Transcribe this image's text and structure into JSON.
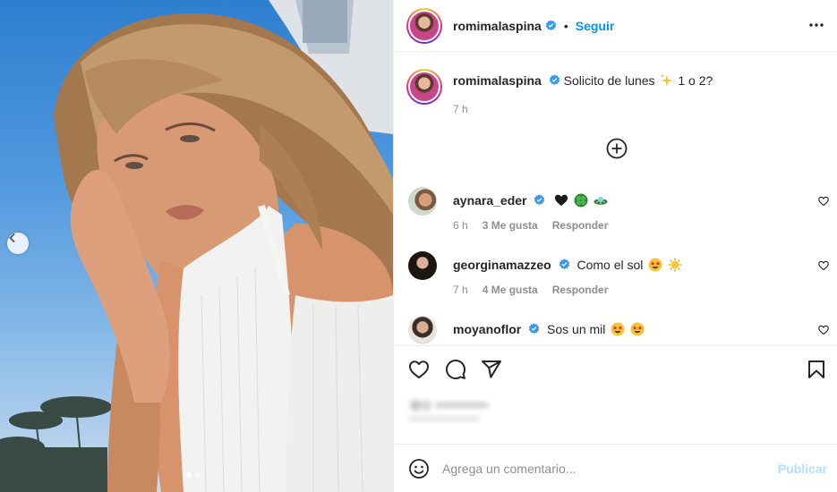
{
  "post": {
    "author": "romimalaspina",
    "follow_label": "Seguir",
    "bullet": "•",
    "caption_text": "Solicito de lunes",
    "caption_suffix": "1 o 2?",
    "caption_time": "7 h",
    "carousel_dots": 2,
    "carousel_active_index": 0
  },
  "comments": [
    {
      "user": "aynara_eder",
      "text": "",
      "time": "6 h",
      "likes": "3 Me gusta",
      "reply": "Responder",
      "emojis": [
        "black-heart",
        "four-leaf-clover",
        "flying-saucer"
      ]
    },
    {
      "user": "georginamazzeo",
      "text": "Como el sol",
      "time": "7 h",
      "likes": "4 Me gusta",
      "reply": "Responder",
      "emojis": [
        "star-struck",
        "sun"
      ]
    },
    {
      "user": "moyanoflor",
      "text": "Sos un mil",
      "time": "",
      "likes": "",
      "reply": "",
      "emojis": [
        "star-struck",
        "star-struck"
      ]
    }
  ],
  "add_comment": {
    "placeholder": "Agrega un comentario...",
    "publish_label": "Publicar"
  },
  "icons": {
    "verified": "verified-badge-icon",
    "more": "more-options-icon",
    "plus": "load-more-comments-icon",
    "heart": "heart-icon",
    "comment": "comment-icon",
    "share": "share-icon",
    "save": "bookmark-icon",
    "emoji": "emoji-icon",
    "prev": "chevron-left-icon"
  },
  "colors": {
    "accent": "#0095f6",
    "verified": "#3897f0",
    "publish_disabled": "#b2dffc",
    "muted": "#8e8e8e"
  }
}
